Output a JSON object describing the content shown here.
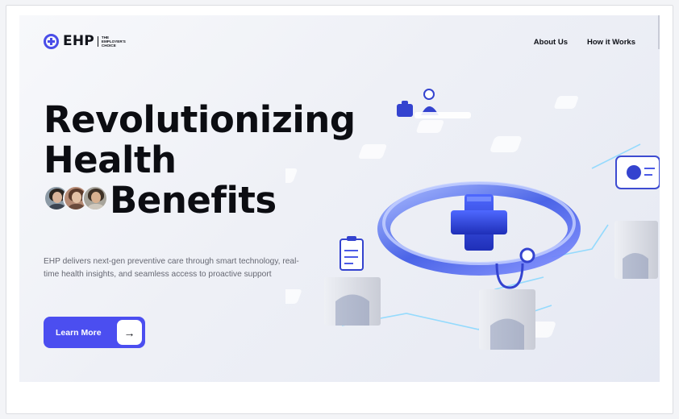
{
  "header": {
    "logo_text": "EHP",
    "logo_tagline": [
      "THE",
      "EMPLOYER'S",
      "CHOICE"
    ],
    "nav": [
      {
        "label": "About Us"
      },
      {
        "label": "How it Works"
      }
    ]
  },
  "hero": {
    "headline_line1": "Revolutionizing",
    "headline_line2": "Health",
    "headline_line3": "Benefits",
    "subtext": "EHP delivers next-gen preventive care through smart technology, real-time health insights, and seamless access to proactive support",
    "cta_label": "Learn More",
    "cta_arrow": "→"
  },
  "icons": [
    "logo-cross-icon",
    "arrow-right-icon",
    "medical-cross-icon",
    "stethoscope-icon",
    "clipboard-icon",
    "health-card-icon",
    "doctor-figure-icon"
  ],
  "colors": {
    "accent": "#4b4ef0",
    "headline": "#0c0d12",
    "subtext": "#666873",
    "hero_bg": "#eef0f6"
  }
}
